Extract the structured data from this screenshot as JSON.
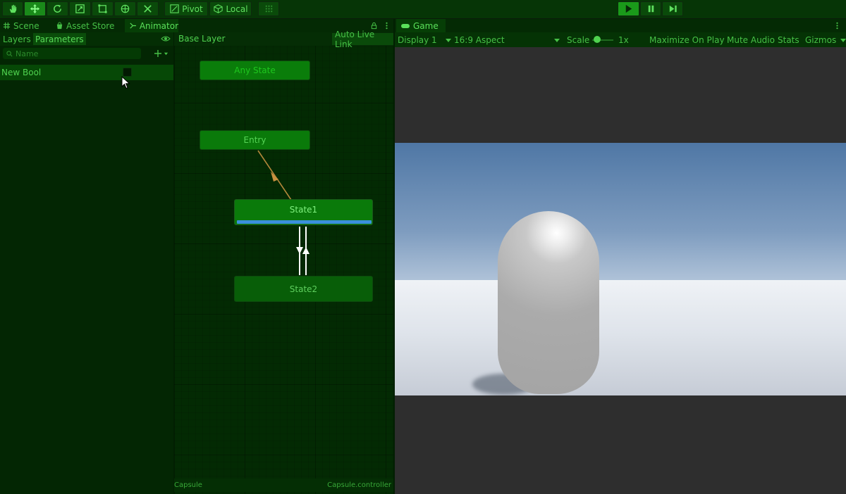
{
  "toolbar": {
    "pivot_label": "Pivot",
    "local_label": "Local",
    "tools": [
      "hand-icon",
      "move-icon",
      "rotate-icon",
      "scale-icon",
      "rect-icon",
      "transform-icon",
      "custom-tool-icon"
    ]
  },
  "left_tabs": {
    "scene": "Scene",
    "asset_store": "Asset Store",
    "animator": "Animator"
  },
  "animator": {
    "subtabs": {
      "layers": "Layers",
      "parameters": "Parameters"
    },
    "search_placeholder": "Name",
    "parameters": [
      {
        "name": "New Bool",
        "value": false
      }
    ],
    "breadcrumb": "Base Layer",
    "auto_live_link": "Auto Live Link",
    "footer_left": "Capsule",
    "footer_right": "Capsule.controller",
    "nodes": {
      "any_state": "Any State",
      "entry": "Entry",
      "state1": "State1",
      "state2": "State2"
    }
  },
  "game": {
    "tab": "Game",
    "display": "Display 1",
    "aspect": "16:9 Aspect",
    "scale_label": "Scale",
    "scale_value": "1x",
    "maximize": "Maximize On Play",
    "mute": "Mute Audio",
    "stats": "Stats",
    "gizmos": "Gizmos"
  },
  "colors": {
    "accent": "#1a8a1a",
    "node": "#0a7d0a",
    "progress": "#3b8fdc"
  }
}
